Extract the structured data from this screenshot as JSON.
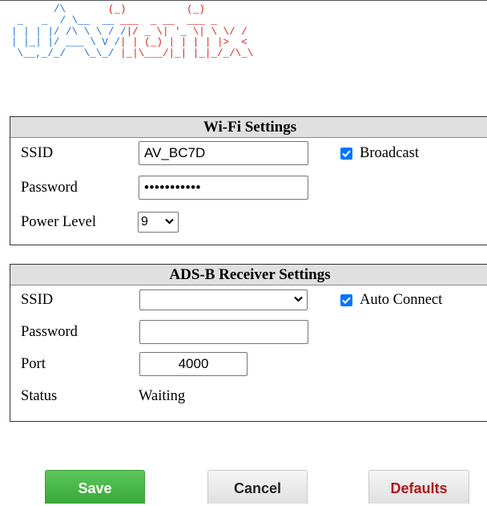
{
  "logo": {
    "alt": "AViation",
    "lines": [
      [
        [
          "b",
          "       /\\       "
        ],
        [
          "r",
          "(_)          (_)"
        ]
      ],
      [
        [
          "b",
          " _   _  / \\__  __"
        ],
        [
          "r",
          " ___  _ __  ___ _"
        ]
      ],
      [
        [
          "b",
          "| | | |/ /\\ \\ \\ / /"
        ],
        [
          "r",
          "|/ _ \\| '_ \\| \\ \\/ /"
        ]
      ],
      [
        [
          "b",
          "| |_| |/ ___ \\ V /"
        ],
        [
          "r",
          "| | (_) | | | | |>  <"
        ]
      ],
      [
        [
          "b",
          " \\__,_/_/   \\_\\_/"
        ],
        [
          "r",
          " |_|\\___/|_| |_|_/_/\\_\\"
        ]
      ]
    ]
  },
  "wifi": {
    "title": "Wi-Fi Settings",
    "ssid_label": "SSID",
    "ssid_value": "AV_BC7D",
    "broadcast_label": "Broadcast",
    "broadcast_checked": true,
    "password_label": "Password",
    "password_value": "•••••••••••",
    "power_label": "Power Level",
    "power_value": "9"
  },
  "adsb": {
    "title": "ADS-B Receiver Settings",
    "ssid_label": "SSID",
    "ssid_value": "",
    "auto_connect_label": "Auto Connect",
    "auto_connect_checked": true,
    "password_label": "Password",
    "password_value": "",
    "port_label": "Port",
    "port_value": "4000",
    "status_label": "Status",
    "status_value": "Waiting"
  },
  "buttons": {
    "save": "Save",
    "cancel": "Cancel",
    "defaults": "Defaults"
  },
  "colors": {
    "logo_blue": "#1a6fd6",
    "logo_red": "#d9261c",
    "checkbox_blue": "#0075ff",
    "save_green": "#4cb84c",
    "defaults_red": "#b01818"
  }
}
